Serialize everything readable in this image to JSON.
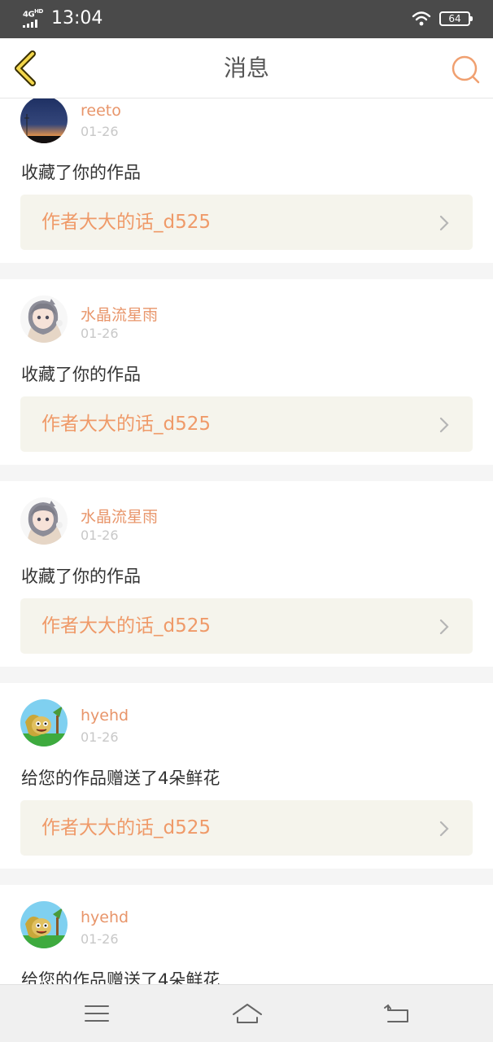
{
  "status_bar": {
    "network": "4G",
    "network_sup": "HD",
    "time": "13:04",
    "battery": "64"
  },
  "nav": {
    "title": "消息"
  },
  "messages": [
    {
      "user": "reeto",
      "date": "01-26",
      "action": "收藏了你的作品",
      "work": "作者大大的话_d525",
      "avatar": "sunset-avatar"
    },
    {
      "user": "水晶流星雨",
      "date": "01-26",
      "action": "收藏了你的作品",
      "work": "作者大大的话_d525",
      "avatar": "anime-girl-avatar"
    },
    {
      "user": "水晶流星雨",
      "date": "01-26",
      "action": "收藏了你的作品",
      "work": "作者大大的话_d525",
      "avatar": "anime-girl-avatar"
    },
    {
      "user": "hyehd",
      "date": "01-26",
      "action": "给您的作品赠送了4朵鲜花",
      "work": "作者大大的话_d525",
      "avatar": "cartoon-avatar"
    },
    {
      "user": "hyehd",
      "date": "01-26",
      "action": "给您的作品赠送了4朵鲜花",
      "avatar": "cartoon-avatar"
    }
  ],
  "colors": {
    "accent": "#ef9a69",
    "status_bar": "#4a4a4a",
    "work_bg": "#f5f4ec"
  }
}
